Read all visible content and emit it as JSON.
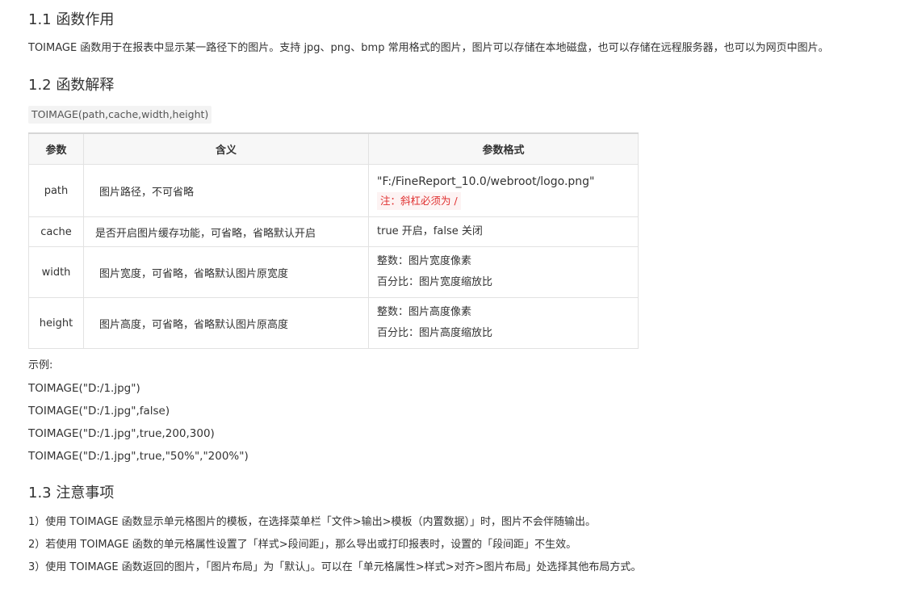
{
  "sections": {
    "s1": {
      "title": "1.1 函数作用",
      "desc": "TOIMAGE 函数用于在报表中显示某一路径下的图片。支持 jpg、png、bmp 常用格式的图片，图片可以存储在本地磁盘，也可以存储在远程服务器，也可以为网页中图片。"
    },
    "s2": {
      "title": "1.2 函数解释",
      "syntax": "TOIMAGE(path,cache,width,height)",
      "table": {
        "headers": [
          "参数",
          "含义",
          "参数格式"
        ],
        "rows": [
          {
            "name": "path",
            "meaning": "图片路径，不可省略",
            "format1": "\"F:/FineReport_10.0/webroot/logo.png\"",
            "note": "注：斜杠必须为 /"
          },
          {
            "name": "cache",
            "meaning": "是否开启图片缓存功能，可省略，省略默认开启",
            "format1": "true 开启，false 关闭"
          },
          {
            "name": "width",
            "meaning": "图片宽度，可省略，省略默认图片原宽度",
            "format1": "整数：图片宽度像素",
            "format2": "百分比：图片宽度缩放比"
          },
          {
            "name": "height",
            "meaning": "图片高度，可省略，省略默认图片原高度",
            "format1": "整数：图片高度像素",
            "format2": "百分比：图片高度缩放比"
          }
        ]
      },
      "example_label": "示例:",
      "examples": [
        "TOIMAGE(\"D:/1.jpg\")",
        "TOIMAGE(\"D:/1.jpg\",false)",
        "TOIMAGE(\"D:/1.jpg\",true,200,300)",
        "TOIMAGE(\"D:/1.jpg\",true,\"50%\",\"200%\")"
      ]
    },
    "s3": {
      "title": "1.3 注意事项",
      "items": [
        "1）使用 TOIMAGE 函数显示单元格图片的模板，在选择菜单栏「文件>输出>模板（内置数据）」时，图片不会伴随输出。",
        "2）若使用 TOIMAGE 函数的单元格属性设置了「样式>段间距」，那么导出或打印报表时，设置的「段间距」不生效。",
        "3）使用 TOIMAGE 函数返回的图片，「图片布局」为「默认」。可以在「单元格属性>样式>对齐>图片布局」处选择其他布局方式。"
      ]
    }
  }
}
